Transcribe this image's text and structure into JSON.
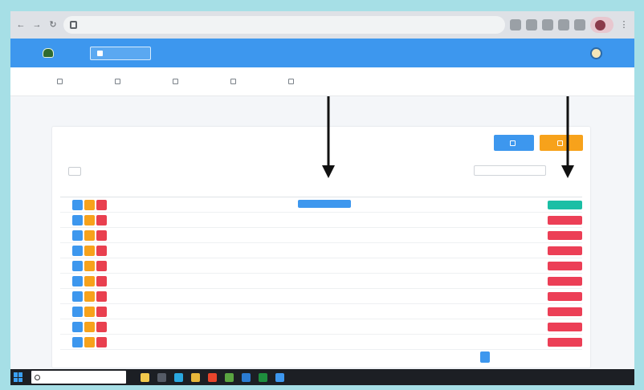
{
  "browser": {
    "url": "",
    "profile_label": ""
  },
  "app": {
    "brand_line1": "",
    "brand_line2": "",
    "dashboard_button": "",
    "user_name": ""
  },
  "menu": [
    {
      "label": ""
    },
    {
      "label": ""
    },
    {
      "label": ""
    },
    {
      "label": ""
    },
    {
      "label": ""
    }
  ],
  "breadcrumb": "",
  "card": {
    "title": "",
    "button_primary": "",
    "button_secondary": "",
    "show_label": "",
    "show_value": "",
    "entries_label": "",
    "search_label": "",
    "search_value": ""
  },
  "table": {
    "headers": [
      "",
      "",
      "",
      "",
      "",
      ""
    ],
    "rows": [
      {
        "no": "",
        "date": "",
        "name": "",
        "desc": "",
        "tag": "",
        "status_chip": true,
        "tag_color": "green"
      },
      {
        "no": "",
        "date": "",
        "name": "",
        "desc": "",
        "tag": "",
        "status_chip": false,
        "tag_color": "red"
      },
      {
        "no": "",
        "date": "",
        "name": "",
        "desc": "",
        "tag": "",
        "status_chip": false,
        "tag_color": "red"
      },
      {
        "no": "",
        "date": "",
        "name": "",
        "desc": "",
        "tag": "",
        "status_chip": false,
        "tag_color": "red"
      },
      {
        "no": "",
        "date": "",
        "name": "",
        "desc": "",
        "tag": "",
        "status_chip": false,
        "tag_color": "red"
      },
      {
        "no": "",
        "date": "",
        "name": "",
        "desc": "",
        "tag": "",
        "status_chip": false,
        "tag_color": "red"
      },
      {
        "no": "",
        "date": "",
        "name": "",
        "desc": "",
        "tag": "",
        "status_chip": false,
        "tag_color": "red"
      },
      {
        "no": "",
        "date": "",
        "name": "",
        "desc": "",
        "tag": "",
        "status_chip": false,
        "tag_color": "red"
      },
      {
        "no": "",
        "date": "",
        "name": "",
        "desc": "",
        "tag": "",
        "status_chip": false,
        "tag_color": "red"
      },
      {
        "no": "",
        "date": "",
        "name": "",
        "desc": "",
        "tag": "",
        "status_chip": false,
        "tag_color": "red"
      }
    ]
  },
  "footer": {
    "info": "",
    "pages": [
      "",
      "",
      "",
      "",
      "",
      "",
      ""
    ]
  },
  "taskbar": {
    "search_placeholder": "",
    "tray_text": "",
    "clock": ""
  },
  "colors": {
    "primary": "#3d97ee",
    "warning": "#f7a21b",
    "danger": "#e9404f",
    "success": "#1bbfa5",
    "background": "#a6dfe6"
  },
  "icons": {
    "view": "eye-icon",
    "edit": "pencil-icon",
    "delete": "trash-icon",
    "annotation": "down-arrow-icon"
  }
}
